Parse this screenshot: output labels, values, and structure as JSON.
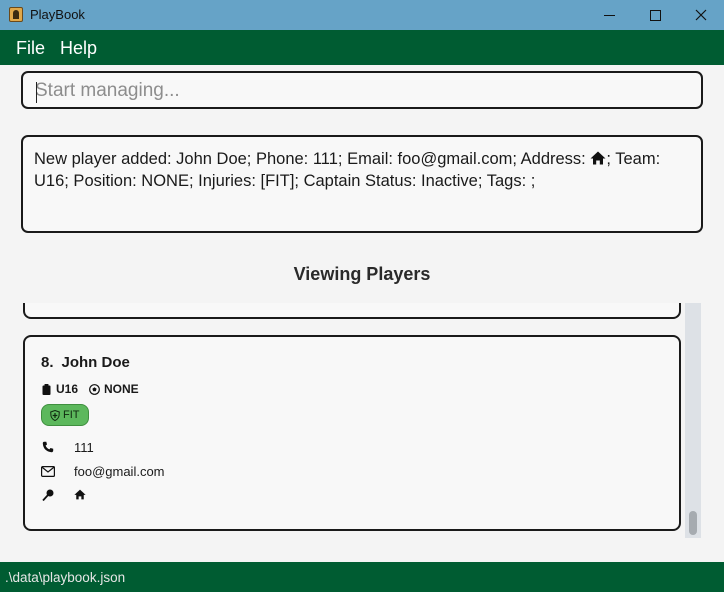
{
  "window": {
    "title": "PlayBook",
    "controls": {
      "minimize": "minimize-icon",
      "maximize": "maximize-icon",
      "close": "close-icon"
    }
  },
  "menu": {
    "file": "File",
    "help": "Help"
  },
  "command_box": {
    "placeholder": "Start managing...",
    "value": ""
  },
  "result": {
    "text_before_icon": "New player added: John Doe; Phone: 111; Email: foo@gmail.com; Address: ",
    "address_icon": "home-icon",
    "text_after_icon": "; Team: U16; Position: NONE; Injuries: [FIT]; Captain Status: Inactive; Tags: ;"
  },
  "list_title": "Viewing Players",
  "player": {
    "index": "8.",
    "name": "John Doe",
    "team": "U16",
    "team_icon": "clipboard-icon",
    "position": "NONE",
    "position_icon": "soccer-ball-icon",
    "injury_status": "FIT",
    "injury_icon": "shield-icon",
    "phone_icon": "phone-icon",
    "phone": "111",
    "email_icon": "mail-icon",
    "email": "foo@gmail.com",
    "address_icon": "location-pin-icon",
    "address_value_icon": "home-icon"
  },
  "status_bar": {
    "path": ".\\data\\playbook.json"
  },
  "colors": {
    "title_bar": "#66a3c7",
    "menu_bar": "#005c32",
    "status_bar": "#005c32",
    "fit_badge": "#5cb85c"
  },
  "scrollbar": {
    "position_fraction": 1.0
  }
}
